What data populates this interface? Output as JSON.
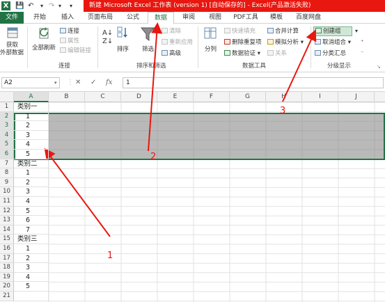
{
  "titlebar": {
    "title": "新建 Microsoft Excel 工作表 (version 1) [自动保存的] - Excel(产品激活失败)",
    "app_icon": "X",
    "qa_icons": [
      "save-icon",
      "undo-icon",
      "redo-icon",
      "customize-icon"
    ]
  },
  "tabs": [
    "文件",
    "开始",
    "插入",
    "页面布局",
    "公式",
    "数据",
    "审阅",
    "视图",
    "PDF工具",
    "模板",
    "百度网盘"
  ],
  "ribbon": {
    "get_external": "获取",
    "get_external2": "外部数据",
    "refresh_all": "全部刷新",
    "connections": "连接",
    "properties": "属性",
    "edit_links": "编辑链接",
    "group_connections": "连接",
    "sort": "排序",
    "filter": "筛选",
    "clear": "清除",
    "reapply": "重新应用",
    "advanced": "高级",
    "group_sort_filter": "排序和筛选",
    "text_to_columns": "分列",
    "flash_fill": "快速填充",
    "remove_duplicates": "删除重复项",
    "data_validation": "数据验证",
    "consolidate": "合并计算",
    "what_if": "模拟分析",
    "relationships": "关系",
    "group_data_tools": "数据工具",
    "group": "创建组",
    "ungroup": "取消组合",
    "subtotal": "分类汇总",
    "group_outline": "分级显示"
  },
  "formula_bar": {
    "name_box": "A2",
    "formula": "1",
    "cancel": "✕",
    "enter": "✓",
    "fx": "fx"
  },
  "columns": [
    "A",
    "B",
    "C",
    "D",
    "E",
    "F",
    "G",
    "H",
    "I",
    "J"
  ],
  "rows": [
    {
      "n": "1",
      "v": "类别一"
    },
    {
      "n": "2",
      "v": "1"
    },
    {
      "n": "3",
      "v": "2"
    },
    {
      "n": "4",
      "v": "3"
    },
    {
      "n": "5",
      "v": "4"
    },
    {
      "n": "6",
      "v": "5"
    },
    {
      "n": "7",
      "v": "类别二"
    },
    {
      "n": "8",
      "v": "1"
    },
    {
      "n": "9",
      "v": "2"
    },
    {
      "n": "10",
      "v": "3"
    },
    {
      "n": "11",
      "v": "4"
    },
    {
      "n": "12",
      "v": "5"
    },
    {
      "n": "13",
      "v": "6"
    },
    {
      "n": "14",
      "v": "7"
    },
    {
      "n": "15",
      "v": "类别三"
    },
    {
      "n": "16",
      "v": "1"
    },
    {
      "n": "17",
      "v": "2"
    },
    {
      "n": "18",
      "v": "3"
    },
    {
      "n": "19",
      "v": "4"
    },
    {
      "n": "20",
      "v": "5"
    },
    {
      "n": "21",
      "v": ""
    }
  ],
  "annotations": [
    "1",
    "2",
    "3"
  ],
  "colors": {
    "excel_green": "#217346",
    "title_red": "#e8170f",
    "selection_gray": "#9e9e9e",
    "annotation_red": "#e8170f"
  }
}
